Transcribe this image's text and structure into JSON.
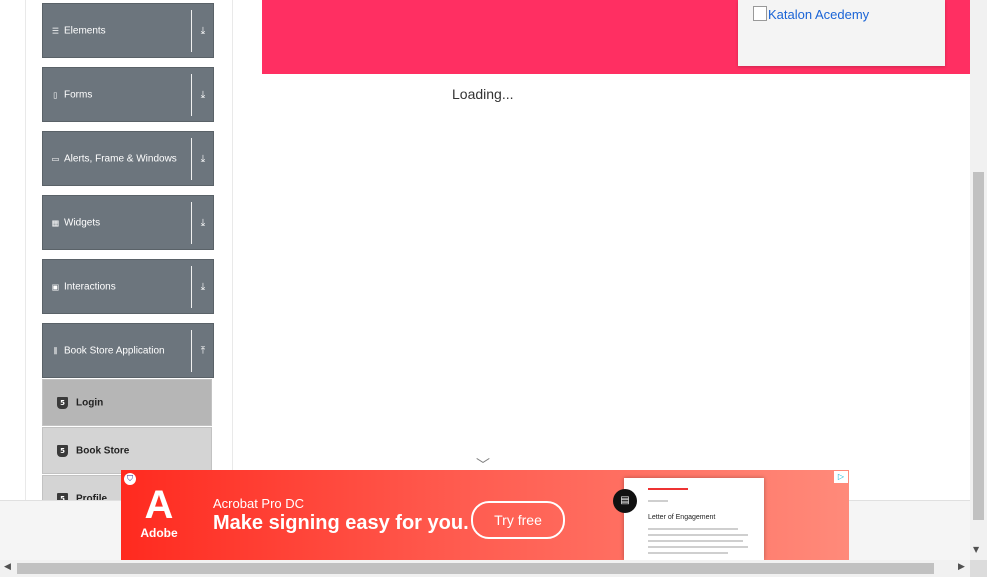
{
  "sidebar": {
    "groups": [
      {
        "label": "Elements",
        "icon": "menu-icon",
        "arrow": "download-arrow"
      },
      {
        "label": "Forms",
        "icon": "form-icon",
        "arrow": "download-arrow"
      },
      {
        "label": "Alerts, Frame & Windows",
        "icon": "window-icon",
        "arrow": "download-arrow"
      },
      {
        "label": "Widgets",
        "icon": "grid-icon",
        "arrow": "download-arrow"
      },
      {
        "label": "Interactions",
        "icon": "interaction-icon",
        "arrow": "download-arrow"
      },
      {
        "label": "Book Store Application",
        "icon": "books-icon",
        "arrow": "upload-arrow"
      }
    ],
    "book_store_items": [
      {
        "label": "Login",
        "active": true
      },
      {
        "label": "Book Store",
        "active": false
      },
      {
        "label": "Profile",
        "active": false
      }
    ]
  },
  "banner": {
    "image_alt": "Katalon Acedemy",
    "color": "#ff2f62"
  },
  "main": {
    "loading_text": "Loading..."
  },
  "ad": {
    "brand": "Adobe",
    "product": "Acrobat Pro DC",
    "headline": "Make signing easy for you.",
    "cta": "Try free",
    "document_title": "Letter of Engagement"
  }
}
